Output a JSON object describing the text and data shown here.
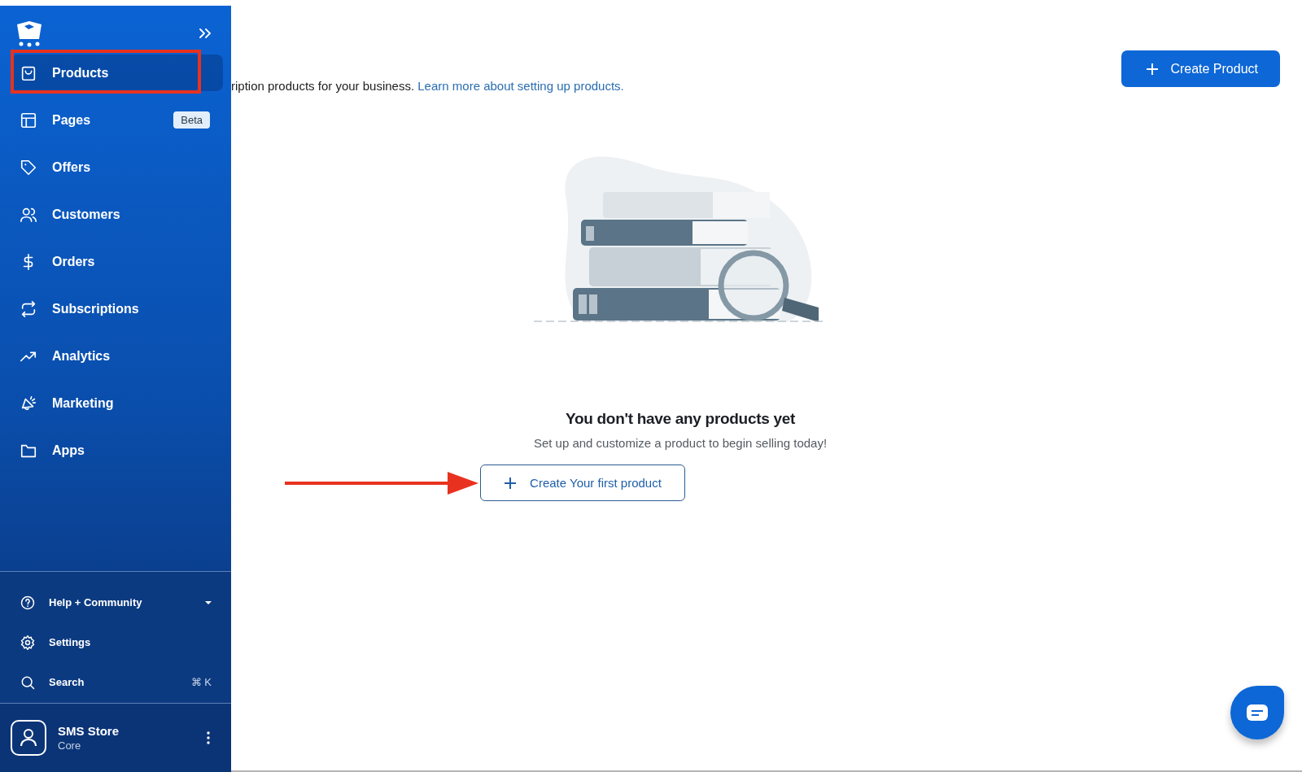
{
  "sidebar": {
    "items": [
      {
        "label": "Products",
        "selected": true
      },
      {
        "label": "Pages",
        "selected": false,
        "badge": "Beta"
      },
      {
        "label": "Offers",
        "selected": false
      },
      {
        "label": "Customers",
        "selected": false
      },
      {
        "label": "Orders",
        "selected": false
      },
      {
        "label": "Subscriptions",
        "selected": false
      },
      {
        "label": "Analytics",
        "selected": false
      },
      {
        "label": "Marketing",
        "selected": false
      },
      {
        "label": "Apps",
        "selected": false
      }
    ],
    "footer_items": [
      {
        "label": "Help + Community",
        "kind": "dropdown"
      },
      {
        "label": "Settings",
        "kind": "link"
      },
      {
        "label": "Search",
        "kind": "shortcut",
        "shortcut": "⌘ K"
      }
    ],
    "account": {
      "name": "SMS Store",
      "plan": "Core"
    }
  },
  "header": {
    "description": "ription products for your business.",
    "link": "Learn more about setting up products.",
    "create_button": "Create Product"
  },
  "empty_state": {
    "title": "You don't have any products yet",
    "subtitle": "Set up and customize a product to begin selling today!",
    "button": "Create Your first product"
  }
}
